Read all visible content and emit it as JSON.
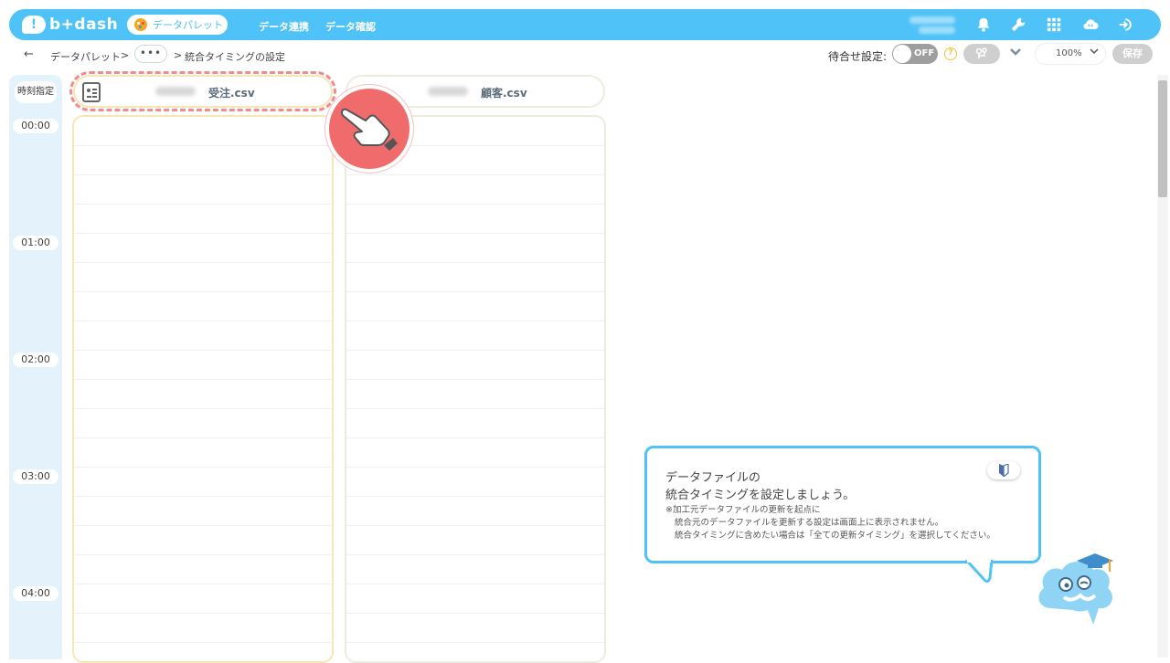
{
  "header": {
    "logo_text": "b+dash",
    "nav_palette": "データパレット",
    "nav_links": [
      "データ連携",
      "データ確認"
    ],
    "icons": [
      "bell-icon",
      "wrench-icon",
      "grid-icon",
      "support-cloud-icon",
      "logout-icon"
    ]
  },
  "toolbar": {
    "back": "←",
    "crumb_1": "データパレット",
    "sep": ">",
    "more": "•••",
    "crumb_current": "統合タイミングの設定",
    "wait_label": "待合せ設定:",
    "toggle_label": "OFF",
    "help": "?",
    "zoom": "100%",
    "save": "保存"
  },
  "timeline": {
    "header": "時刻指定",
    "times": [
      "00:00",
      "01:00",
      "02:00",
      "03:00",
      "04:00"
    ]
  },
  "files": [
    {
      "name": "受注.csv"
    },
    {
      "name": "顧客.csv"
    }
  ],
  "tooltip": {
    "line1": "データファイルの",
    "line2": "統合タイミングを設定しましょう。",
    "note1": "※加工元データファイルの更新を起点に",
    "note2": "統合元のデータファイルを更新する設定は画面上に表示されません。",
    "note3": "統合タイミングに含めたい場合は「全ての更新タイミング」を選択してください。"
  },
  "colors": {
    "brand": "#4fc3f7",
    "highlight": "#f06b6b",
    "file_border": "#f7e7b3"
  }
}
